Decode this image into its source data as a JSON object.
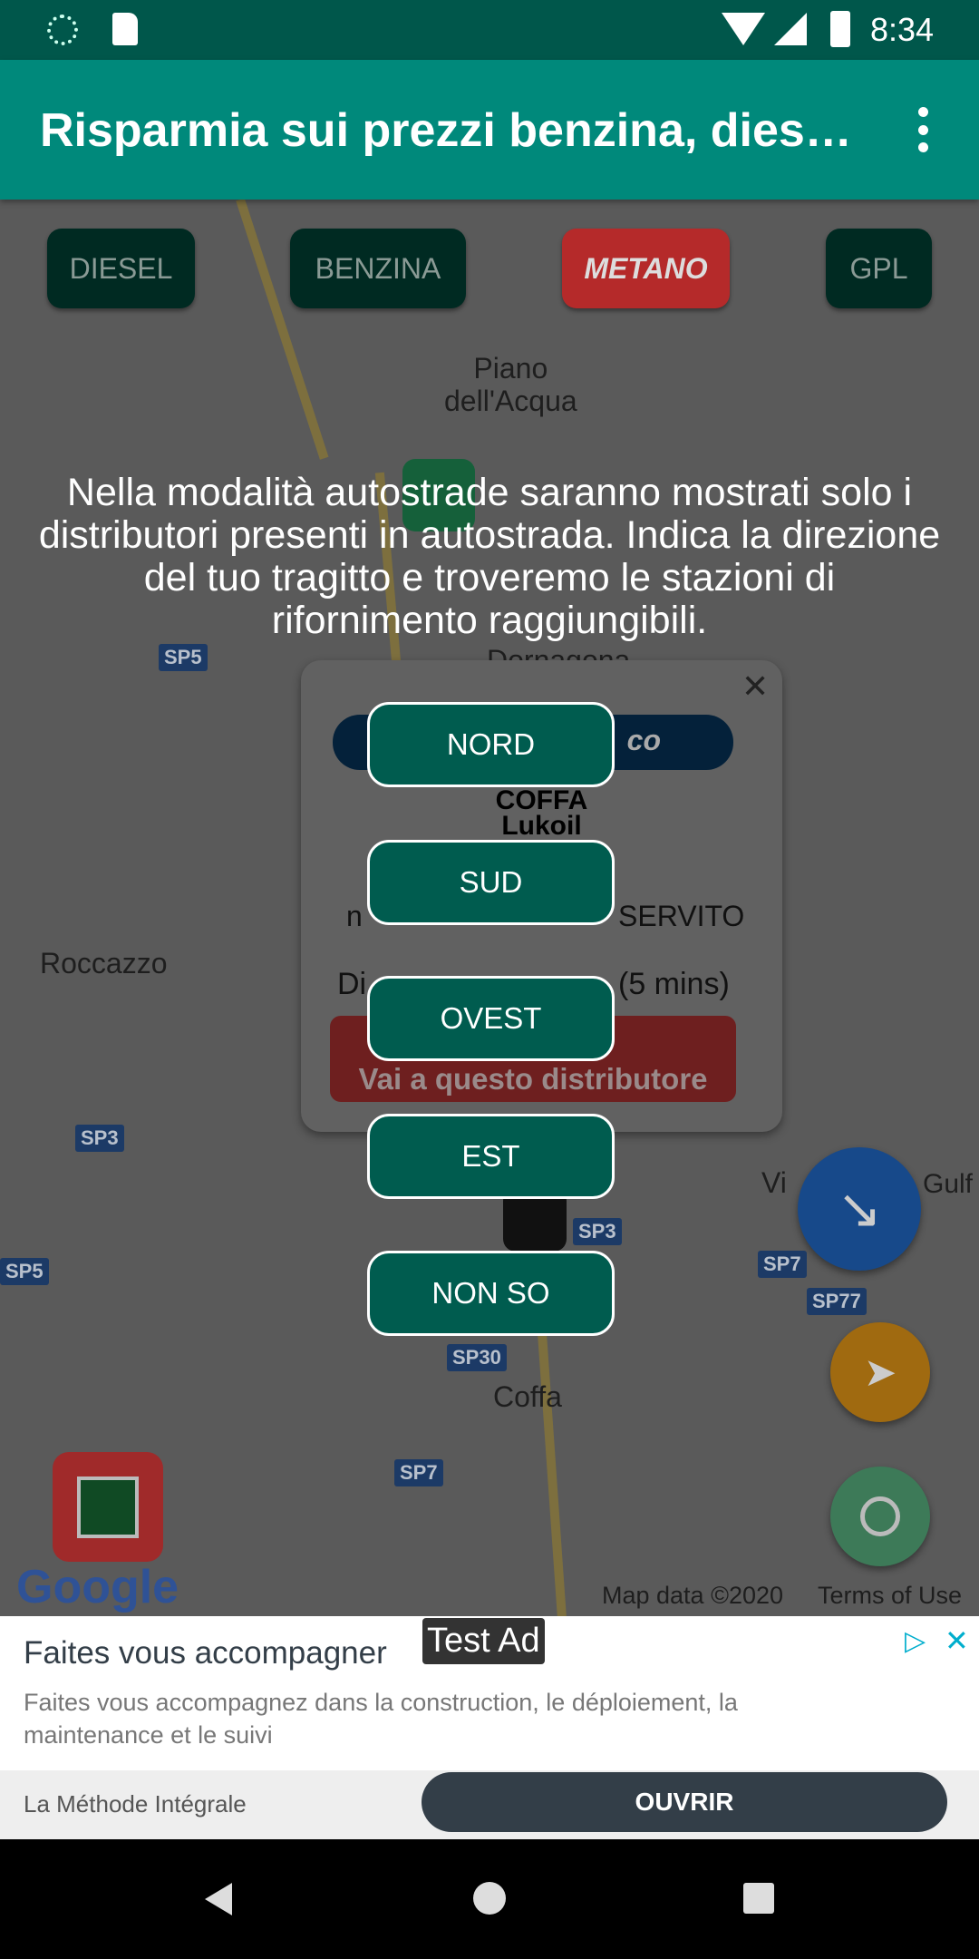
{
  "status_bar": {
    "time": "8:34"
  },
  "app_bar": {
    "title": "Risparmia sui prezzi benzina, dies…",
    "menu_icon": "more-vert-icon"
  },
  "fuel_types": [
    {
      "label": "DIESEL",
      "selected": false
    },
    {
      "label": "BENZINA",
      "selected": false
    },
    {
      "label": "METANO",
      "selected": true
    },
    {
      "label": "GPL",
      "selected": false
    }
  ],
  "map": {
    "places": [
      "Piano\ndell'Acqua",
      "Dornagona",
      "Roccazzo",
      "Coffa",
      "Vi",
      "Gulf"
    ],
    "roads": [
      "SP5",
      "SP3",
      "SP5",
      "SP3",
      "SP7",
      "SP77",
      "SP30",
      "SP7"
    ],
    "attribution": "Map data ©2020",
    "terms": "Terms of Use",
    "logo": "Google"
  },
  "station_popup": {
    "badge": "co",
    "name": "COFFA",
    "brand": "Lukoil",
    "service": "SERVITO",
    "service_prefix": "n",
    "distance_prefix": "Di",
    "distance_suffix": "(5 mins)",
    "go_button": "Vai a questo distributore"
  },
  "overlay": {
    "message": "Nella modalità autostrade saranno mostrati solo i distributori presenti in autostrada. Indica la direzione del tuo tragitto e troveremo le stazioni di rifornimento raggiungibili.",
    "directions": [
      "NORD",
      "SUD",
      "OVEST",
      "EST",
      "NON SO"
    ]
  },
  "colors": {
    "primary": "#00897b",
    "primary_dark": "#00574b",
    "direction_button": "#005c4f",
    "metano": "#d32f2f",
    "fab_blue": "#1565c0",
    "fab_orange": "#f59b00",
    "fab_green": "#4caf7a"
  },
  "ad": {
    "title": "Faites vous accompagner",
    "badge": "Test Ad",
    "body": "Faites vous accompagnez dans la construction, le déploiement, la maintenance et le suivi",
    "advertiser": "La Méthode Intégrale",
    "cta": "OUVRIR"
  }
}
